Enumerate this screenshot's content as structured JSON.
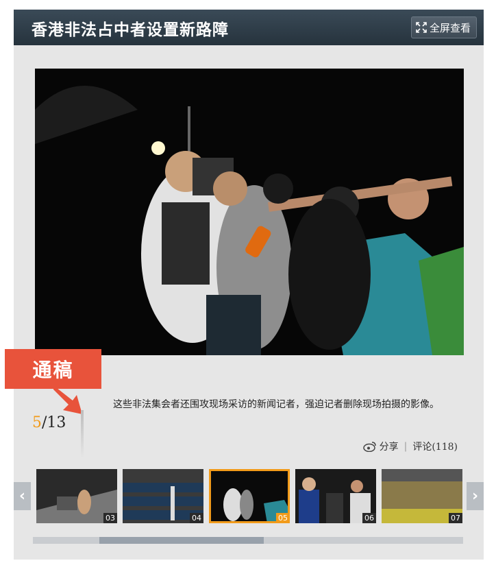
{
  "header": {
    "title": "香港非法占中者设置新路障",
    "fullscreen_label": "全屏查看"
  },
  "badge": {
    "label": "通稿"
  },
  "counter": {
    "current": "5",
    "total": "/13"
  },
  "caption": "这些非法集会者还围攻现场采访的新闻记者，强迫记者删除现场拍摄的影像。",
  "actions": {
    "share_label": "分享",
    "comment_label": "评论(118)"
  },
  "thumbnails": [
    {
      "num": "03"
    },
    {
      "num": "04"
    },
    {
      "num": "05"
    },
    {
      "num": "06"
    },
    {
      "num": "07"
    }
  ],
  "colors": {
    "accent": "#f29b1a",
    "badge": "#e8533b",
    "header": "#2e3b46"
  }
}
